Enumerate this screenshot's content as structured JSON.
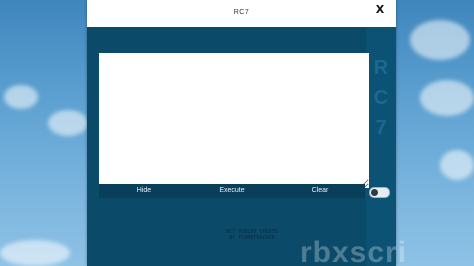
{
  "window": {
    "title": "RC7",
    "close_label": "X"
  },
  "sidebar": {
    "letters": [
      "R",
      "C",
      "7"
    ]
  },
  "editor": {
    "value": ""
  },
  "buttons": {
    "hide": "Hide",
    "execute": "Execute",
    "clear": "Clear"
  },
  "toggle": {
    "state": "off"
  },
  "footer": {
    "line1": "RC7 ROBLOX CHEATS",
    "line2": "BY FLAMEFRACKER"
  },
  "watermark": {
    "text": "rbxscri"
  },
  "colors": {
    "window_bg": "#0f4f6e",
    "panel_bg": "#0b4a69",
    "button_bar": "#0a3f5b",
    "desktop_sky": "#5b9fd0"
  }
}
